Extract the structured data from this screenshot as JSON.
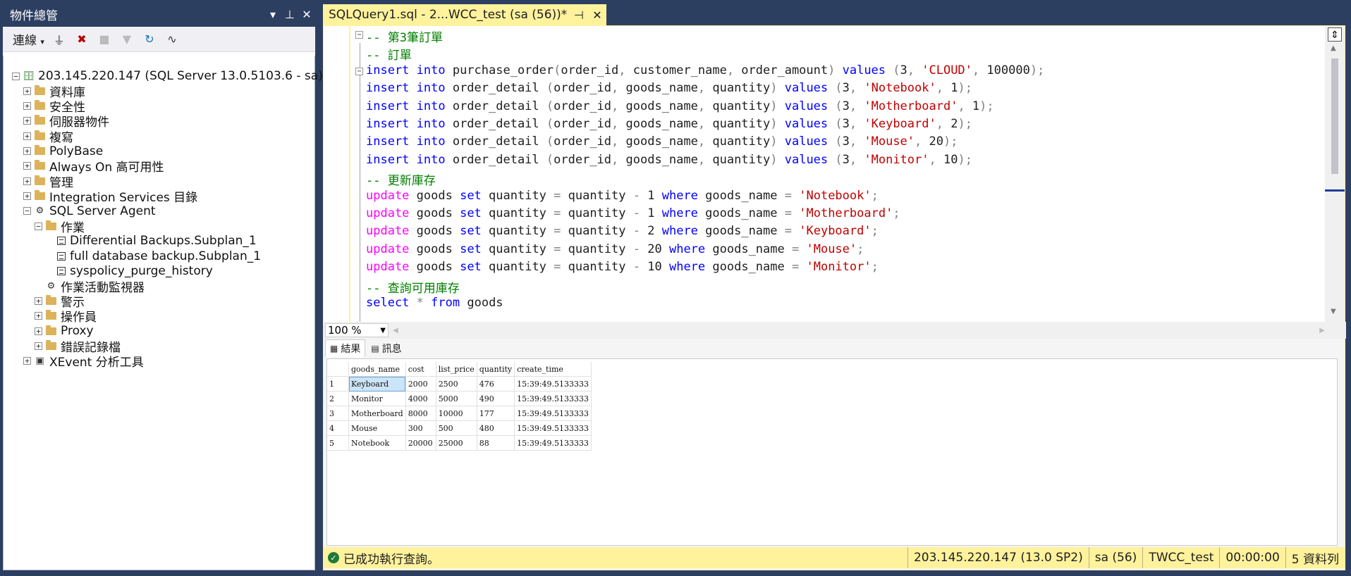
{
  "object_explorer": {
    "title": "物件總管",
    "connect_label": "連線",
    "tree": [
      {
        "label": "203.145.220.147 (SQL Server 13.0.5103.6 - sa)",
        "expander": "⊟",
        "icon": "server-icon"
      },
      {
        "label": "資料庫",
        "expander": "⊞",
        "icon": "folder-icon"
      },
      {
        "label": "安全性",
        "expander": "⊞",
        "icon": "folder-icon"
      },
      {
        "label": "伺服器物件",
        "expander": "⊞",
        "icon": "folder-icon"
      },
      {
        "label": "複寫",
        "expander": "⊞",
        "icon": "folder-icon"
      },
      {
        "label": "PolyBase",
        "expander": "⊞",
        "icon": "folder-icon"
      },
      {
        "label": "Always On 高可用性",
        "expander": "⊞",
        "icon": "folder-icon"
      },
      {
        "label": "管理",
        "expander": "⊞",
        "icon": "folder-icon"
      },
      {
        "label": "Integration Services 目錄",
        "expander": "⊞",
        "icon": "folder-icon"
      },
      {
        "label": "SQL Server Agent",
        "expander": "⊟",
        "icon": "agent-icon"
      },
      {
        "label": "作業",
        "expander": "⊟",
        "icon": "folder-icon"
      },
      {
        "label": "Differential Backups.Subplan_1",
        "expander": "",
        "icon": "job-icon"
      },
      {
        "label": "full database backup.Subplan_1",
        "expander": "",
        "icon": "job-icon"
      },
      {
        "label": "syspolicy_purge_history",
        "expander": "",
        "icon": "job-icon"
      },
      {
        "label": "作業活動監視器",
        "expander": "",
        "icon": "monitor-icon"
      },
      {
        "label": "警示",
        "expander": "⊞",
        "icon": "folder-icon"
      },
      {
        "label": "操作員",
        "expander": "⊞",
        "icon": "folder-icon"
      },
      {
        "label": "Proxy",
        "expander": "⊞",
        "icon": "folder-icon"
      },
      {
        "label": "錯誤記錄檔",
        "expander": "⊞",
        "icon": "folder-icon"
      },
      {
        "label": "XEvent 分析工具",
        "expander": "⊞",
        "icon": "xevent-icon"
      }
    ]
  },
  "editor": {
    "tab_title": "SQLQuery1.sql - 2...WCC_test (sa (56))*",
    "zoom": "100 %",
    "lines": [
      [
        {
          "t": "-- 第3筆訂單",
          "c": "cm"
        }
      ],
      [
        {
          "t": "-- 訂單",
          "c": "cm"
        }
      ],
      [
        {
          "t": "insert into",
          "c": "kw"
        },
        {
          "t": " purchase_order",
          "c": ""
        },
        {
          "t": "(",
          "c": "gr"
        },
        {
          "t": "order_id",
          "c": ""
        },
        {
          "t": ", ",
          "c": "gr"
        },
        {
          "t": "customer_name",
          "c": ""
        },
        {
          "t": ", ",
          "c": "gr"
        },
        {
          "t": "order_amount",
          "c": ""
        },
        {
          "t": ") ",
          "c": "gr"
        },
        {
          "t": "values",
          "c": "kw"
        },
        {
          "t": " (",
          "c": "gr"
        },
        {
          "t": "3",
          "c": ""
        },
        {
          "t": ", ",
          "c": "gr"
        },
        {
          "t": "'CLOUD'",
          "c": "str"
        },
        {
          "t": ", ",
          "c": "gr"
        },
        {
          "t": "100000",
          "c": ""
        },
        {
          "t": ");",
          "c": "gr"
        }
      ],
      [
        {
          "t": "insert into",
          "c": "kw"
        },
        {
          "t": " order_detail ",
          "c": ""
        },
        {
          "t": "(",
          "c": "gr"
        },
        {
          "t": "order_id",
          "c": ""
        },
        {
          "t": ", ",
          "c": "gr"
        },
        {
          "t": "goods_name",
          "c": ""
        },
        {
          "t": ", ",
          "c": "gr"
        },
        {
          "t": "quantity",
          "c": ""
        },
        {
          "t": ") ",
          "c": "gr"
        },
        {
          "t": "values",
          "c": "kw"
        },
        {
          "t": " (",
          "c": "gr"
        },
        {
          "t": "3",
          "c": ""
        },
        {
          "t": ", ",
          "c": "gr"
        },
        {
          "t": "'Notebook'",
          "c": "str"
        },
        {
          "t": ", ",
          "c": "gr"
        },
        {
          "t": "1",
          "c": ""
        },
        {
          "t": ");",
          "c": "gr"
        }
      ],
      [
        {
          "t": "insert into",
          "c": "kw"
        },
        {
          "t": " order_detail ",
          "c": ""
        },
        {
          "t": "(",
          "c": "gr"
        },
        {
          "t": "order_id",
          "c": ""
        },
        {
          "t": ", ",
          "c": "gr"
        },
        {
          "t": "goods_name",
          "c": ""
        },
        {
          "t": ", ",
          "c": "gr"
        },
        {
          "t": "quantity",
          "c": ""
        },
        {
          "t": ") ",
          "c": "gr"
        },
        {
          "t": "values",
          "c": "kw"
        },
        {
          "t": " (",
          "c": "gr"
        },
        {
          "t": "3",
          "c": ""
        },
        {
          "t": ", ",
          "c": "gr"
        },
        {
          "t": "'Motherboard'",
          "c": "str"
        },
        {
          "t": ", ",
          "c": "gr"
        },
        {
          "t": "1",
          "c": ""
        },
        {
          "t": ");",
          "c": "gr"
        }
      ],
      [
        {
          "t": "insert into",
          "c": "kw"
        },
        {
          "t": " order_detail ",
          "c": ""
        },
        {
          "t": "(",
          "c": "gr"
        },
        {
          "t": "order_id",
          "c": ""
        },
        {
          "t": ", ",
          "c": "gr"
        },
        {
          "t": "goods_name",
          "c": ""
        },
        {
          "t": ", ",
          "c": "gr"
        },
        {
          "t": "quantity",
          "c": ""
        },
        {
          "t": ") ",
          "c": "gr"
        },
        {
          "t": "values",
          "c": "kw"
        },
        {
          "t": " (",
          "c": "gr"
        },
        {
          "t": "3",
          "c": ""
        },
        {
          "t": ", ",
          "c": "gr"
        },
        {
          "t": "'Keyboard'",
          "c": "str"
        },
        {
          "t": ", ",
          "c": "gr"
        },
        {
          "t": "2",
          "c": ""
        },
        {
          "t": ");",
          "c": "gr"
        }
      ],
      [
        {
          "t": "insert into",
          "c": "kw"
        },
        {
          "t": " order_detail ",
          "c": ""
        },
        {
          "t": "(",
          "c": "gr"
        },
        {
          "t": "order_id",
          "c": ""
        },
        {
          "t": ", ",
          "c": "gr"
        },
        {
          "t": "goods_name",
          "c": ""
        },
        {
          "t": ", ",
          "c": "gr"
        },
        {
          "t": "quantity",
          "c": ""
        },
        {
          "t": ") ",
          "c": "gr"
        },
        {
          "t": "values",
          "c": "kw"
        },
        {
          "t": " (",
          "c": "gr"
        },
        {
          "t": "3",
          "c": ""
        },
        {
          "t": ", ",
          "c": "gr"
        },
        {
          "t": "'Mouse'",
          "c": "str"
        },
        {
          "t": ", ",
          "c": "gr"
        },
        {
          "t": "20",
          "c": ""
        },
        {
          "t": ");",
          "c": "gr"
        }
      ],
      [
        {
          "t": "insert into",
          "c": "kw"
        },
        {
          "t": " order_detail ",
          "c": ""
        },
        {
          "t": "(",
          "c": "gr"
        },
        {
          "t": "order_id",
          "c": ""
        },
        {
          "t": ", ",
          "c": "gr"
        },
        {
          "t": "goods_name",
          "c": ""
        },
        {
          "t": ", ",
          "c": "gr"
        },
        {
          "t": "quantity",
          "c": ""
        },
        {
          "t": ") ",
          "c": "gr"
        },
        {
          "t": "values",
          "c": "kw"
        },
        {
          "t": " (",
          "c": "gr"
        },
        {
          "t": "3",
          "c": ""
        },
        {
          "t": ", ",
          "c": "gr"
        },
        {
          "t": "'Monitor'",
          "c": "str"
        },
        {
          "t": ", ",
          "c": "gr"
        },
        {
          "t": "10",
          "c": ""
        },
        {
          "t": ");",
          "c": "gr"
        }
      ],
      [
        {
          "t": "-- 更新庫存",
          "c": "cm"
        }
      ],
      [
        {
          "t": "update",
          "c": "fn"
        },
        {
          "t": " goods ",
          "c": ""
        },
        {
          "t": "set",
          "c": "kw"
        },
        {
          "t": " quantity ",
          "c": ""
        },
        {
          "t": "=",
          "c": "gr"
        },
        {
          "t": " quantity ",
          "c": ""
        },
        {
          "t": "-",
          "c": "gr"
        },
        {
          "t": " 1 ",
          "c": ""
        },
        {
          "t": "where",
          "c": "kw"
        },
        {
          "t": " goods_name ",
          "c": ""
        },
        {
          "t": "=",
          "c": "gr"
        },
        {
          "t": " ",
          "c": ""
        },
        {
          "t": "'Notebook'",
          "c": "str"
        },
        {
          "t": ";",
          "c": "gr"
        }
      ],
      [
        {
          "t": "update",
          "c": "fn"
        },
        {
          "t": " goods ",
          "c": ""
        },
        {
          "t": "set",
          "c": "kw"
        },
        {
          "t": " quantity ",
          "c": ""
        },
        {
          "t": "=",
          "c": "gr"
        },
        {
          "t": " quantity ",
          "c": ""
        },
        {
          "t": "-",
          "c": "gr"
        },
        {
          "t": " 1 ",
          "c": ""
        },
        {
          "t": "where",
          "c": "kw"
        },
        {
          "t": " goods_name ",
          "c": ""
        },
        {
          "t": "=",
          "c": "gr"
        },
        {
          "t": " ",
          "c": ""
        },
        {
          "t": "'Motherboard'",
          "c": "str"
        },
        {
          "t": ";",
          "c": "gr"
        }
      ],
      [
        {
          "t": "update",
          "c": "fn"
        },
        {
          "t": " goods ",
          "c": ""
        },
        {
          "t": "set",
          "c": "kw"
        },
        {
          "t": " quantity ",
          "c": ""
        },
        {
          "t": "=",
          "c": "gr"
        },
        {
          "t": " quantity ",
          "c": ""
        },
        {
          "t": "-",
          "c": "gr"
        },
        {
          "t": " 2 ",
          "c": ""
        },
        {
          "t": "where",
          "c": "kw"
        },
        {
          "t": " goods_name ",
          "c": ""
        },
        {
          "t": "=",
          "c": "gr"
        },
        {
          "t": " ",
          "c": ""
        },
        {
          "t": "'Keyboard'",
          "c": "str"
        },
        {
          "t": ";",
          "c": "gr"
        }
      ],
      [
        {
          "t": "update",
          "c": "fn"
        },
        {
          "t": " goods ",
          "c": ""
        },
        {
          "t": "set",
          "c": "kw"
        },
        {
          "t": " quantity ",
          "c": ""
        },
        {
          "t": "=",
          "c": "gr"
        },
        {
          "t": " quantity ",
          "c": ""
        },
        {
          "t": "-",
          "c": "gr"
        },
        {
          "t": " 20 ",
          "c": ""
        },
        {
          "t": "where",
          "c": "kw"
        },
        {
          "t": " goods_name ",
          "c": ""
        },
        {
          "t": "=",
          "c": "gr"
        },
        {
          "t": " ",
          "c": ""
        },
        {
          "t": "'Mouse'",
          "c": "str"
        },
        {
          "t": ";",
          "c": "gr"
        }
      ],
      [
        {
          "t": "update",
          "c": "fn"
        },
        {
          "t": " goods ",
          "c": ""
        },
        {
          "t": "set",
          "c": "kw"
        },
        {
          "t": " quantity ",
          "c": ""
        },
        {
          "t": "=",
          "c": "gr"
        },
        {
          "t": " quantity ",
          "c": ""
        },
        {
          "t": "-",
          "c": "gr"
        },
        {
          "t": " 10 ",
          "c": ""
        },
        {
          "t": "where",
          "c": "kw"
        },
        {
          "t": " goods_name ",
          "c": ""
        },
        {
          "t": "=",
          "c": "gr"
        },
        {
          "t": " ",
          "c": ""
        },
        {
          "t": "'Monitor'",
          "c": "str"
        },
        {
          "t": ";",
          "c": "gr"
        }
      ],
      [
        {
          "t": "-- 查詢可用庫存",
          "c": "cm"
        }
      ],
      [
        {
          "t": "select",
          "c": "kw"
        },
        {
          "t": " ",
          "c": ""
        },
        {
          "t": "*",
          "c": "gr"
        },
        {
          "t": " ",
          "c": ""
        },
        {
          "t": "from",
          "c": "kw"
        },
        {
          "t": " goods",
          "c": ""
        }
      ]
    ]
  },
  "results": {
    "tab_results": "結果",
    "tab_messages": "訊息",
    "columns": [
      "goods_name",
      "cost",
      "list_price",
      "quantity",
      "create_time"
    ],
    "rows": [
      [
        "1",
        "Keyboard",
        "2000",
        "2500",
        "476",
        "15:39:49.5133333"
      ],
      [
        "2",
        "Monitor",
        "4000",
        "5000",
        "490",
        "15:39:49.5133333"
      ],
      [
        "3",
        "Motherboard",
        "8000",
        "10000",
        "177",
        "15:39:49.5133333"
      ],
      [
        "4",
        "Mouse",
        "300",
        "500",
        "480",
        "15:39:49.5133333"
      ],
      [
        "5",
        "Notebook",
        "20000",
        "25000",
        "88",
        "15:39:49.5133333"
      ]
    ]
  },
  "status": {
    "message": "已成功執行查詢。",
    "server": "203.145.220.147 (13.0 SP2)",
    "user": "sa (56)",
    "database": "TWCC_test",
    "elapsed": "00:00:00",
    "rows": "5 資料列"
  },
  "colors": {
    "accent_yellow": "#fff29d",
    "title_bg": "#2d3f61"
  }
}
